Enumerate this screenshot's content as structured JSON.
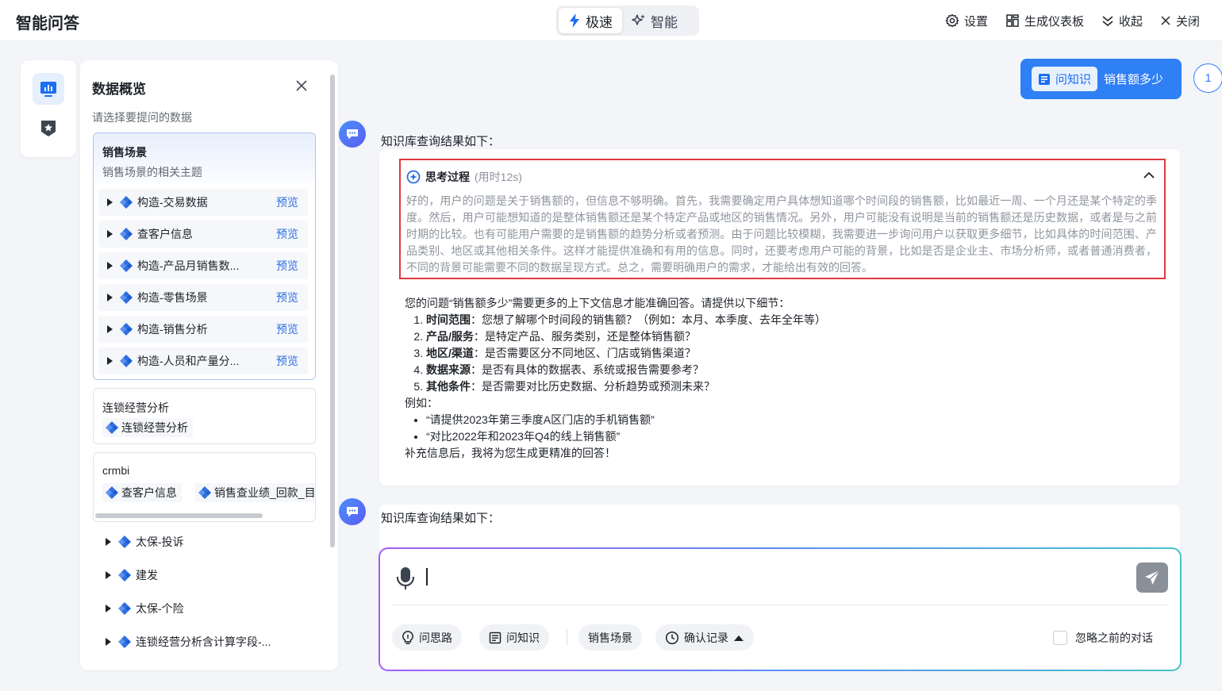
{
  "app": {
    "title": "智能问答"
  },
  "modes": [
    {
      "label": "极速",
      "active": true
    },
    {
      "label": "智能",
      "active": false
    }
  ],
  "top_actions": [
    {
      "label": "设置",
      "icon": "gear-icon"
    },
    {
      "label": "生成仪表板",
      "icon": "dashboard-icon"
    },
    {
      "label": "收起",
      "icon": "collapse-icon"
    },
    {
      "label": "关闭",
      "icon": "close-icon"
    }
  ],
  "panel": {
    "title": "数据概览",
    "subtitle": "请选择要提问的数据",
    "sales": {
      "title": "销售场景",
      "desc": "销售场景的相关主题",
      "preview_label": "预览",
      "items": [
        "构造-交易数据",
        "查客户信息",
        "构造-产品月销售数...",
        "构造-零售场景",
        "构造-销售分析",
        "构造-人员和产量分..."
      ]
    },
    "chain": {
      "title": "连锁经营分析",
      "chips": [
        "连锁经营分析"
      ]
    },
    "crmbi": {
      "title": "crmbi",
      "chips": [
        "查客户信息",
        "销售查业绩_回款_目"
      ]
    },
    "more": [
      "太保-投诉",
      "建发",
      "太保-个险",
      "连锁经营分析含计算字段-..."
    ]
  },
  "chat": {
    "user_query": {
      "tag": "问知识",
      "text": "销售额多少",
      "index": "1"
    },
    "answer_head": "知识库查询结果如下：",
    "thinking": {
      "title": "思考过程",
      "duration": "(用时12s)",
      "text": "好的，用户的问题是关于销售额的，但信息不够明确。首先，我需要确定用户具体想知道哪个时间段的销售额，比如最近一周、一个月还是某个特定的季度。然后，用户可能想知道的是整体销售额还是某个特定产品或地区的销售情况。另外，用户可能没有说明是当前的销售额还是历史数据，或者是与之前时期的比较。也有可能用户需要的是销售额的趋势分析或者预测。由于问题比较模糊，我需要进一步询问用户以获取更多细节，比如具体的时间范围、产品类别、地区或其他相关条件。这样才能提供准确和有用的信息。同时，还要考虑用户可能的背景，比如是否是企业主、市场分析师，或者普通消费者，不同的背景可能需要不同的数据呈现方式。总之，需要明确用户的需求，才能给出有效的回答。"
    },
    "reply": {
      "intro": "您的问题“销售额多少”需要更多的上下文信息才能准确回答。请提供以下细节：",
      "details": [
        {
          "term": "时间范围",
          "text": "：您想了解哪个时间段的销售额？（例如：本月、本季度、去年全年等）"
        },
        {
          "term": "产品/服务",
          "text": "：是特定产品、服务类别，还是整体销售额？"
        },
        {
          "term": "地区/渠道",
          "text": "：是否需要区分不同地区、门店或销售渠道？"
        },
        {
          "term": "数据来源",
          "text": "：是否有具体的数据表、系统或报告需要参考？"
        },
        {
          "term": "其他条件",
          "text": "：是否需要对比历史数据、分析趋势或预测未来？"
        }
      ],
      "example_label": "例如：",
      "examples": [
        "“请提供2023年第三季度A区门店的手机销售额”",
        "“对比2022年和2023年Q4的线上销售额”"
      ],
      "closing": "补充信息后，我将为您生成更精准的回答！"
    },
    "answer2_head": "知识库查询结果如下："
  },
  "input": {
    "value": "",
    "pills": [
      "问思路",
      "问知识",
      "销售场景",
      "确认记录"
    ],
    "ignore_label": "忽略之前的对话",
    "ignore_checked": false
  },
  "colors": {
    "accent": "#2f7ff5",
    "highlight_border": "#e0393e",
    "link": "#2f6fe0"
  }
}
